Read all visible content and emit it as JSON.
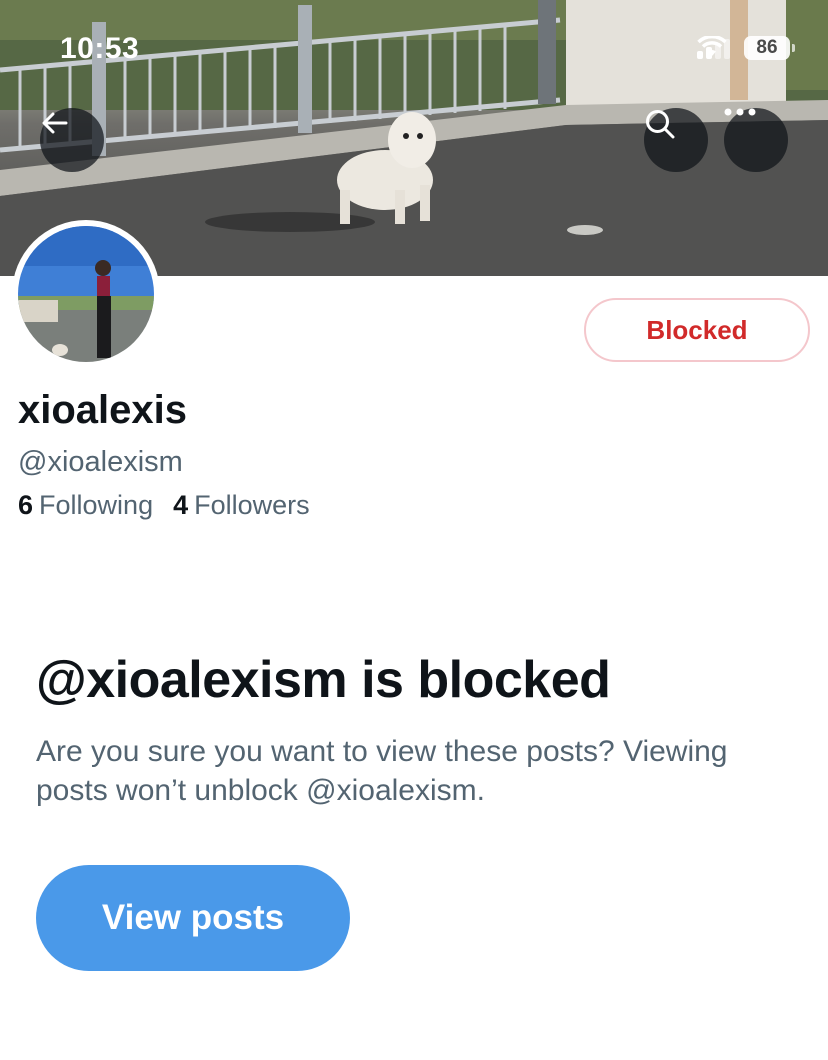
{
  "status_bar": {
    "time": "10:53",
    "battery": "86"
  },
  "header": {
    "back_icon": "arrow-left-icon",
    "search_icon": "search-icon",
    "more_icon": "more-horizontal-icon"
  },
  "profile": {
    "display_name": "xioalexis",
    "handle": "@xioalexism",
    "following_count": "6",
    "following_label": "Following",
    "followers_count": "4",
    "followers_label": "Followers",
    "blocked_button_label": "Blocked"
  },
  "blocked_notice": {
    "title": "@xioalexism is blocked",
    "description": "Are you sure you want to view these posts? Viewing posts won’t unblock @xioalexism.",
    "view_button_label": "View posts"
  },
  "colors": {
    "accent": "#4a99e9",
    "blocked_red": "#d12a2a",
    "secondary_text": "#536471",
    "primary_text": "#0f1419"
  }
}
